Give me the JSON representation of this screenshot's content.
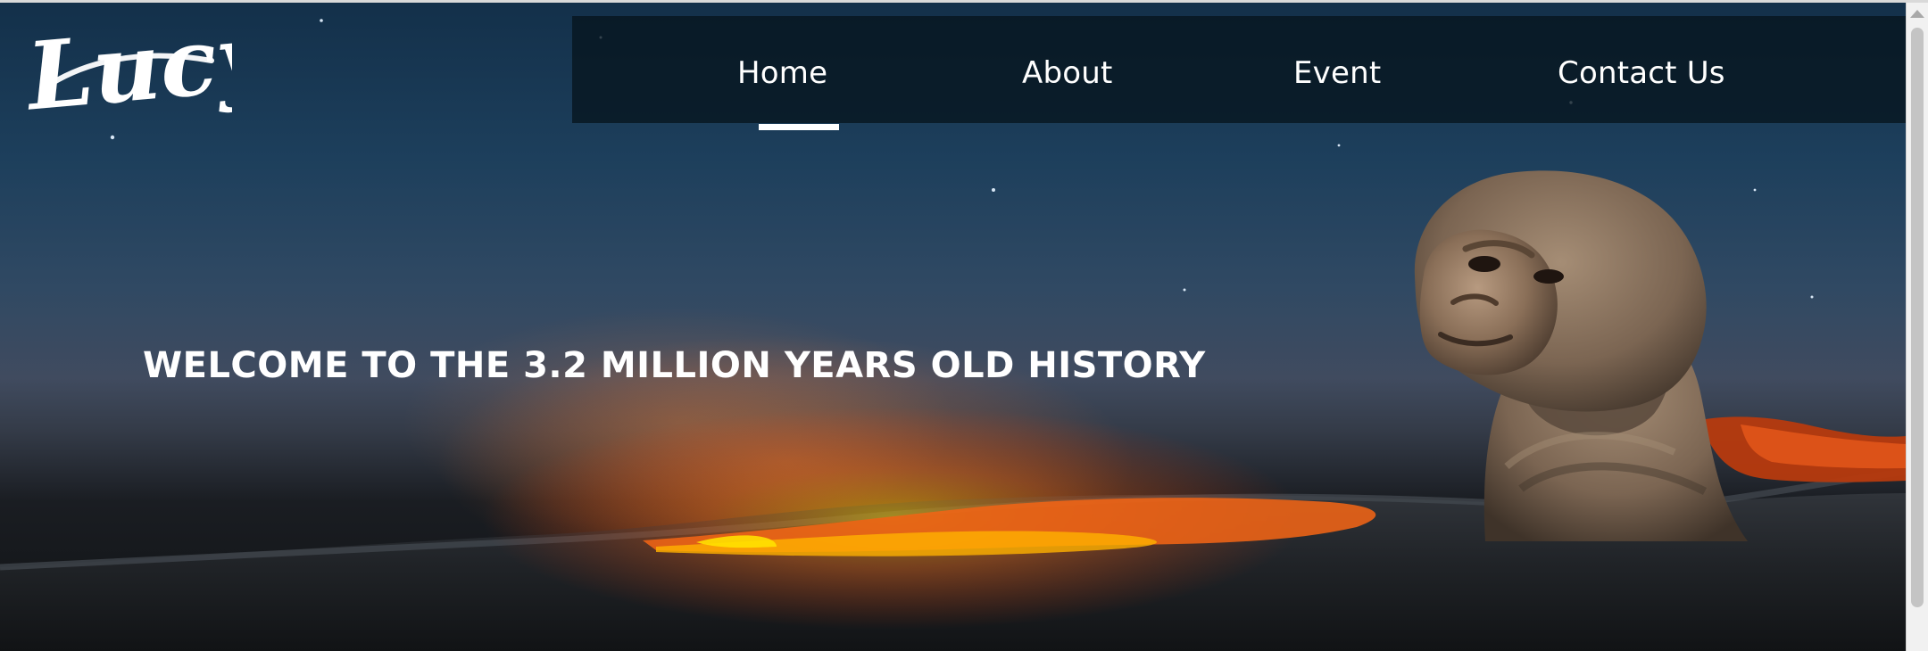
{
  "brand": {
    "logo_text": "Lucy"
  },
  "nav": {
    "items": [
      {
        "label": "Home",
        "active": true
      },
      {
        "label": "About",
        "active": false
      },
      {
        "label": "Event",
        "active": false
      },
      {
        "label": "Contact Us",
        "active": false
      }
    ]
  },
  "hero": {
    "headline": "WELCOME TO THE 3.2 MILLION YEARS OLD HISTORY"
  },
  "colors": {
    "nav_background": "#07141e",
    "text": "#ffffff",
    "sky": "#1d3f5c",
    "lava": "#ff7a1a"
  },
  "icons": {
    "scroll_up": "scroll-up-icon"
  }
}
